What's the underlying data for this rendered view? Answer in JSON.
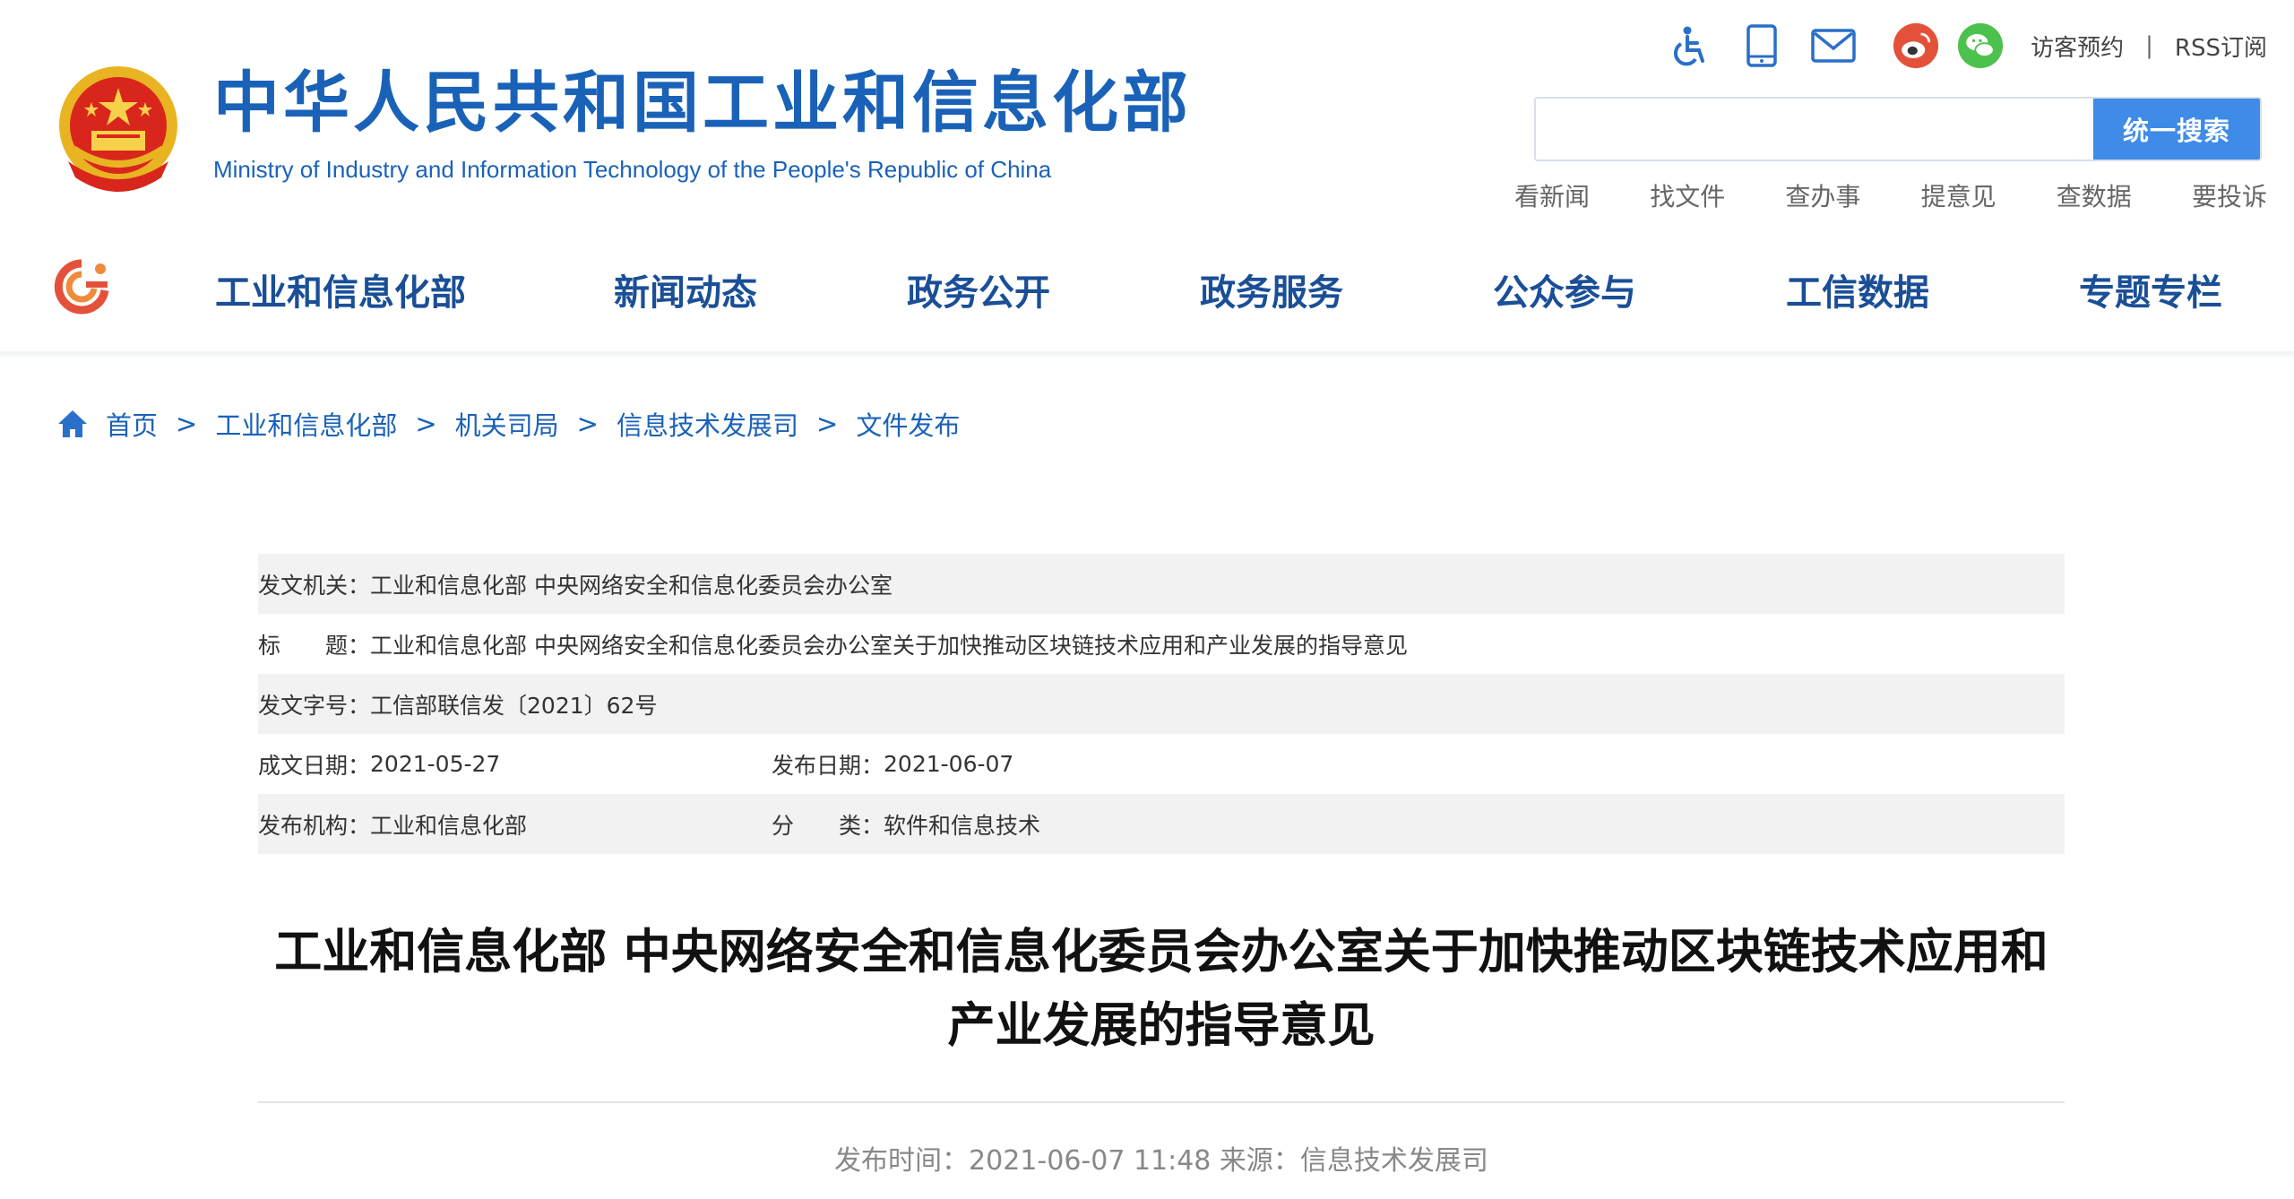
{
  "header": {
    "title": "中华人民共和国工业和信息化部",
    "subtitle": "Ministry of Industry and Information Technology of the People's Republic of China",
    "emblem": "national-emblem",
    "tools": {
      "accessibility_icon": "wheelchair-icon",
      "mobile_icon": "mobile-phone-icon",
      "mail_icon": "mail-icon",
      "weibo_icon": "weibo-icon",
      "wechat_icon": "wechat-icon",
      "visitor_booking": "访客预约",
      "separator": "|",
      "rss": "RSS订阅"
    },
    "search": {
      "placeholder": "",
      "button": "统一搜索"
    },
    "quick_links": [
      "看新闻",
      "找文件",
      "查办事",
      "提意见",
      "查数据",
      "要投诉"
    ]
  },
  "nav": {
    "logo": "ministry-logo",
    "items": [
      "工业和信息化部",
      "新闻动态",
      "政务公开",
      "政务服务",
      "公众参与",
      "工信数据",
      "专题专栏"
    ]
  },
  "breadcrumb": {
    "home_icon": "home-icon",
    "items": [
      "首页",
      "工业和信息化部",
      "机关司局",
      "信息技术发展司",
      "文件发布"
    ],
    "separator": ">"
  },
  "meta": {
    "issuer_label": "发文机关：",
    "issuer": "工业和信息化部 中央网络安全和信息化委员会办公室",
    "title_label": "标　　题：",
    "title": "工业和信息化部 中央网络安全和信息化委员会办公室关于加快推动区块链技术应用和产业发展的指导意见",
    "doc_no_label": "发文字号：",
    "doc_no": "工信部联信发〔2021〕62号",
    "created_label": "成文日期：",
    "created": "2021-05-27",
    "published_label": "发布日期：",
    "published": "2021-06-07",
    "org_label": "发布机构：",
    "org": "工业和信息化部",
    "category_label": "分　　类：",
    "category": "软件和信息技术"
  },
  "article": {
    "title_line1": "工业和信息化部 中央网络安全和信息化委员会办公室关于加快推动区块链技术应用和",
    "title_line2": "产业发展的指导意见",
    "publish_time": "发布时间：2021-06-07 11:48  来源：信息技术发展司"
  },
  "colors": {
    "brand_blue": "#1a62b8",
    "nav_blue": "#1a4f97",
    "search_button": "#3e8be8",
    "row_shade": "#f2f2f2"
  }
}
